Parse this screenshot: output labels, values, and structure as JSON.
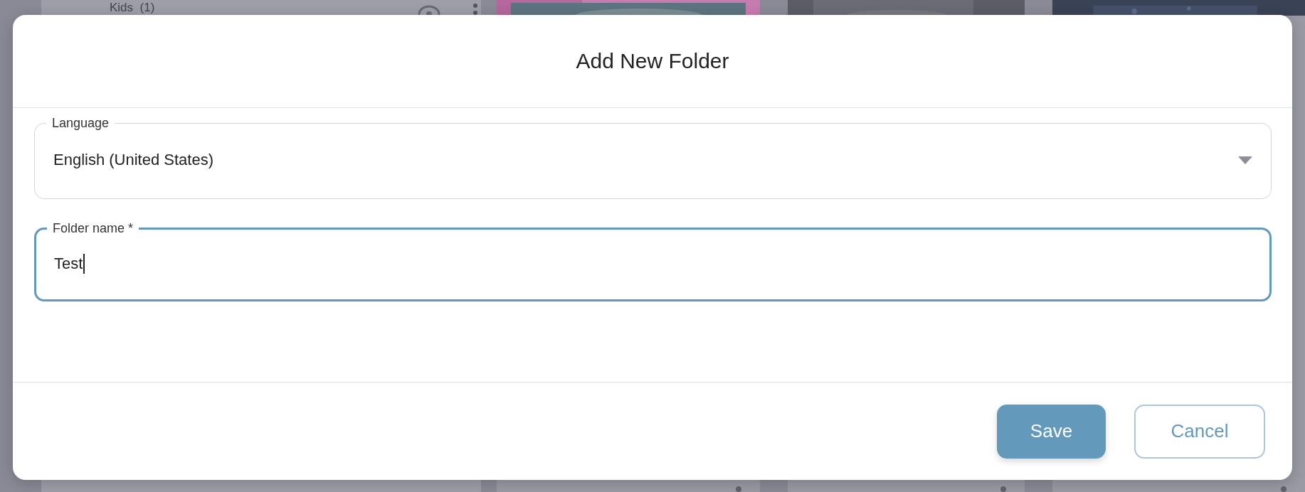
{
  "background": {
    "sidebar_item": "Kids  (1)"
  },
  "dialog": {
    "title": "Add New Folder",
    "fields": [
      {
        "kind": "select",
        "label": "Language",
        "value": "English (United States)",
        "focused": false
      },
      {
        "kind": "text",
        "label": "Folder name *",
        "value": "Test",
        "focused": true
      }
    ],
    "buttons": [
      {
        "kind": "primary",
        "label": "Save"
      },
      {
        "kind": "secondary",
        "label": "Cancel"
      }
    ]
  }
}
